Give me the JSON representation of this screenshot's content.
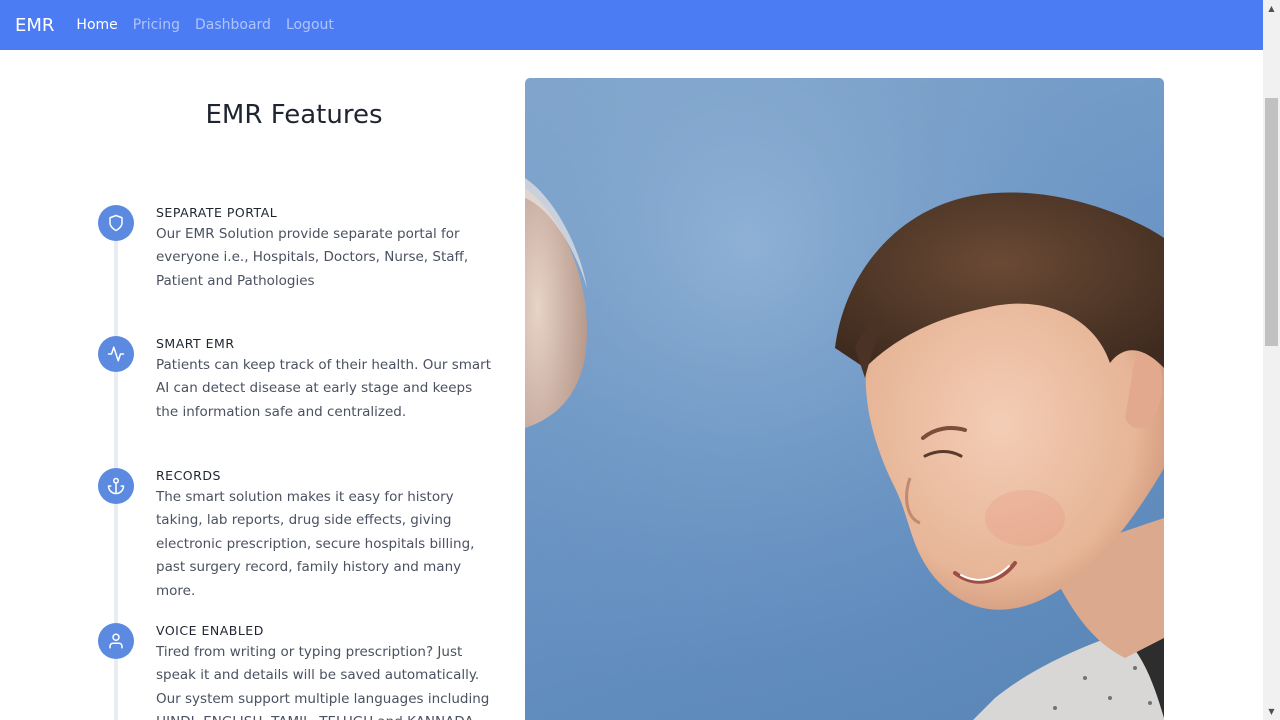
{
  "navbar": {
    "brand": "EMR",
    "links": [
      "Home",
      "Pricing",
      "Dashboard",
      "Logout"
    ],
    "active": "Home",
    "background_color": "#4c7cf3"
  },
  "main": {
    "title": "EMR Features",
    "features": [
      {
        "icon": "shield-icon",
        "title": "SEPARATE PORTAL",
        "text": "Our EMR Solution provide separate portal for everyone i.e., Hospitals, Doctors, Nurse, Staff, Patient and Pathologies"
      },
      {
        "icon": "activity-icon",
        "title": "SMART EMR",
        "text": "Patients can keep track of their health. Our smart AI can detect disease at early stage and keeps the information safe and centralized."
      },
      {
        "icon": "anchor-icon",
        "title": "RECORDS",
        "text": "The smart solution makes it easy for history taking, lab reports, drug side effects, giving electronic prescription, secure hospitals billing, past surgery record, family history and many more."
      },
      {
        "icon": "user-icon",
        "title": "VOICE ENABLED",
        "text": "Tired from writing or typing prescription? Just speak it and details will be saved automatically. Our system support multiple languages including HINDI, ENGLISH, TAMIL, TELUGU and KANNADA."
      }
    ],
    "icon_color": "#5b8ae0"
  }
}
